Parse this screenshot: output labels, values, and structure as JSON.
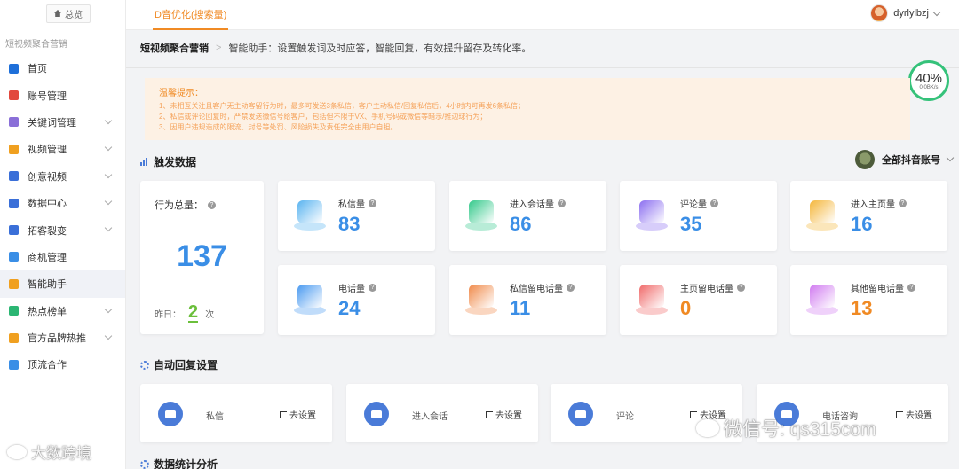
{
  "sidebar": {
    "home_tab": "总览",
    "section_label": "短视频聚合营销",
    "items": [
      {
        "label": "首页",
        "icon": "home-icon",
        "color": "#1e6fd9",
        "chevron": false
      },
      {
        "label": "账号管理",
        "icon": "user-icon",
        "color": "#e2483d",
        "chevron": false
      },
      {
        "label": "关键词管理",
        "icon": "keyword-icon",
        "color": "#8a6fd8",
        "chevron": true
      },
      {
        "label": "视频管理",
        "icon": "video-icon",
        "color": "#f0a020",
        "chevron": true
      },
      {
        "label": "创意视频",
        "icon": "grid-icon",
        "color": "#3a6fd8",
        "chevron": true
      },
      {
        "label": "数据中心",
        "icon": "monitor-icon",
        "color": "#3a6fd8",
        "chevron": true
      },
      {
        "label": "拓客裂变",
        "icon": "split-icon",
        "color": "#3a6fd8",
        "chevron": true
      },
      {
        "label": "商机管理",
        "icon": "book-icon",
        "color": "#3a8ee6",
        "chevron": false
      },
      {
        "label": "智能助手",
        "icon": "headset-icon",
        "color": "#f0a020",
        "chevron": false
      },
      {
        "label": "热点榜单",
        "icon": "bar-chart-icon",
        "color": "#2bb673",
        "chevron": true
      },
      {
        "label": "官方品牌热推",
        "icon": "sparkle-icon",
        "color": "#f0a020",
        "chevron": true
      },
      {
        "label": "顶流合作",
        "icon": "stack-icon",
        "color": "#3a8ee6",
        "chevron": false
      }
    ],
    "active_index": 8
  },
  "header": {
    "active_tab": "D音优化(搜索量)",
    "username": "dyrlylbzj"
  },
  "breadcrumb": {
    "root": "短视频聚合营销",
    "current": "智能助手：设置触发词及时应答，智能回复，有效提升留存及转化率。"
  },
  "ring": {
    "percent": "40%",
    "speed": "0.0BK/s"
  },
  "notice": {
    "title": "温馨提示：",
    "lines": [
      "1、未相互关注且客户无主动客留行为时，最多可发送3条私信，客户主动私信/回复私信后，4小时内可再发6条私信；",
      "2、私信或评论回复时，严禁发送微信号给客户，包括但不限于VX、手机号码或微信等暗示/推边球行为；",
      "3、因用户违规造成的限流、封号等处罚、风险损失及责任完全由用户自担。"
    ]
  },
  "trigger": {
    "title": "触发数据",
    "account": "全部抖音账号",
    "total_label": "行为总量：",
    "total": "137",
    "yesterday_label": "昨日：",
    "yesterday": "2",
    "yesterday_unit": "次",
    "stats": [
      {
        "label": "私信量",
        "value": "83",
        "icon": "message-icon",
        "color": "#3a8ee6",
        "icon_color": "#5ab4f0"
      },
      {
        "label": "进入会话量",
        "value": "86",
        "icon": "chat-icon",
        "color": "#3a8ee6",
        "icon_color": "#34c98b"
      },
      {
        "label": "评论量",
        "value": "35",
        "icon": "comment-icon",
        "color": "#3a8ee6",
        "icon_color": "#8c6ff0"
      },
      {
        "label": "进入主页量",
        "value": "16",
        "icon": "house-icon",
        "color": "#3a8ee6",
        "icon_color": "#f4b63a"
      },
      {
        "label": "电话量",
        "value": "24",
        "icon": "phone-icon",
        "color": "#3a8ee6",
        "icon_color": "#4a9af0"
      },
      {
        "label": "私信留电话量",
        "value": "11",
        "icon": "mail-phone-icon",
        "color": "#3a8ee6",
        "icon_color": "#f08a4a"
      },
      {
        "label": "主页留电话量",
        "value": "0",
        "icon": "homepage-phone-icon",
        "color": "#f08a24",
        "icon_color": "#f06a6a"
      },
      {
        "label": "其他留电话量",
        "value": "13",
        "icon": "other-phone-icon",
        "color": "#f08a24",
        "icon_color": "#d07af0"
      }
    ]
  },
  "auto_reply": {
    "title": "自动回复设置",
    "items": [
      {
        "name": "私信",
        "action": "去设置"
      },
      {
        "name": "进入会话",
        "action": "去设置"
      },
      {
        "name": "评论",
        "action": "去设置"
      },
      {
        "name": "电话咨询",
        "action": "去设置"
      }
    ]
  },
  "stats_section": {
    "title": "数据统计分析"
  },
  "watermarks": {
    "left": "大数跨境",
    "right": "微信号: qs315com"
  }
}
